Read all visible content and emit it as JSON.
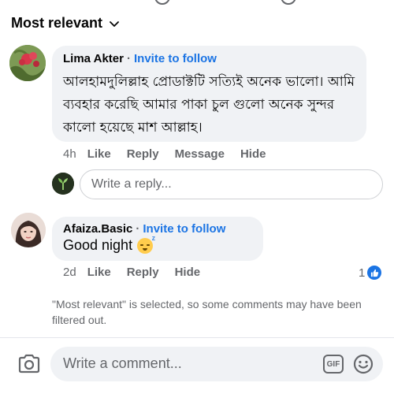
{
  "sort": {
    "label": "Most relevant",
    "icon": "chevron-down-icon"
  },
  "comments": [
    {
      "author": "Lima Akter",
      "separator": "·",
      "invite": "Invite to follow",
      "text": "আলহামদুলিল্লাহ প্রোডাক্টটি সত্যিই অনেক ভালো। আমি ব্যবহার করেছি আমার পাকা চুল গুলো অনেক সুন্দর কালো হয়েছে মাশ আল্লাহ।",
      "time": "4h",
      "actions": {
        "like": "Like",
        "reply": "Reply",
        "message": "Message",
        "hide": "Hide"
      },
      "avatar_icon": "flower-avatar"
    },
    {
      "author": "Afaiza.Basic",
      "separator": "·",
      "invite": "Invite to follow",
      "text": "Good night",
      "emoji": "sleeping-face-emoji",
      "time": "2d",
      "actions": {
        "like": "Like",
        "reply": "Reply",
        "hide": "Hide"
      },
      "like_count": "1",
      "avatar_icon": "profile-photo-avatar"
    }
  ],
  "reply_box": {
    "placeholder": "Write a reply..."
  },
  "notice": "\"Most relevant\" is selected, so some comments may have been filtered out.",
  "composer": {
    "placeholder": "Write a comment...",
    "gif_label": "GIF",
    "icons": [
      "camera-icon",
      "gif-icon",
      "smiley-icon"
    ]
  },
  "colors": {
    "link_blue": "#1b74e4",
    "bubble_bg": "#f0f2f5",
    "muted_text": "#65676b",
    "text": "#050505"
  }
}
